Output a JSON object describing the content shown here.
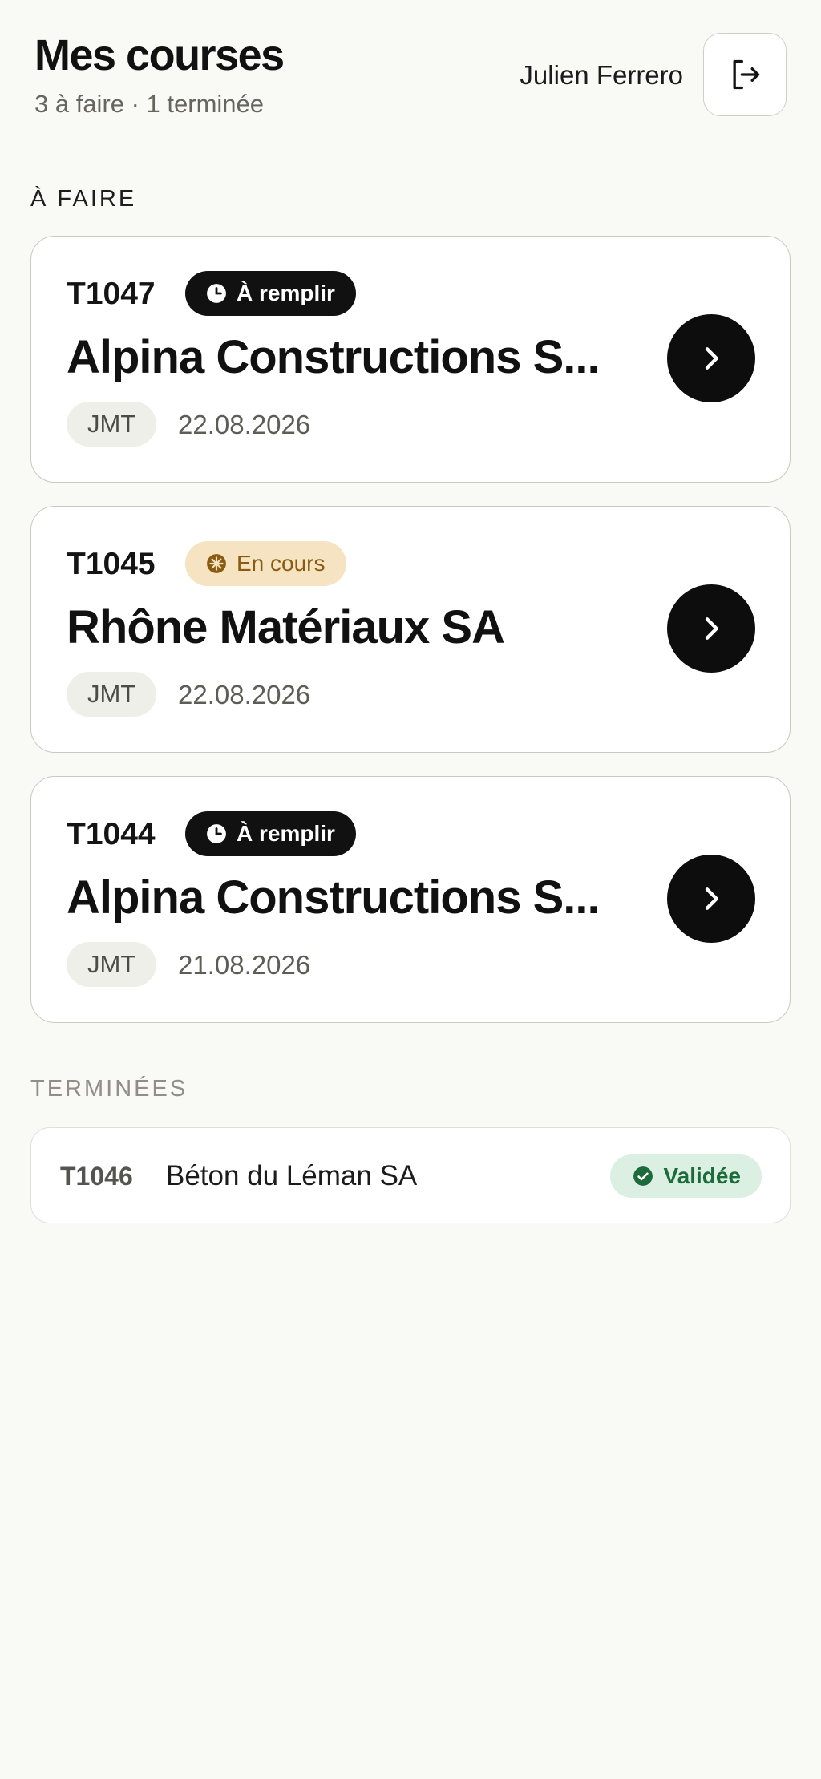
{
  "header": {
    "title": "Mes courses",
    "subtitle": "3 à faire · 1 terminée",
    "user_name": "Julien Ferrero",
    "logout_icon": "logout-icon"
  },
  "sections": {
    "todo_label": "À FAIRE",
    "done_label": "TERMINÉES"
  },
  "todo": [
    {
      "id": "T1047",
      "status": "À remplir",
      "status_icon": "clock-icon",
      "client": "Alpina Constructions S...",
      "code": "JMT",
      "date": "22.08.2026"
    },
    {
      "id": "T1045",
      "status": "En cours",
      "status_icon": "progress-icon",
      "client": "Rhône Matériaux SA",
      "code": "JMT",
      "date": "22.08.2026"
    },
    {
      "id": "T1044",
      "status": "À remplir",
      "status_icon": "clock-icon",
      "client": "Alpina Constructions S...",
      "code": "JMT",
      "date": "21.08.2026"
    }
  ],
  "done": [
    {
      "id": "T1046",
      "client": "Béton du Léman SA",
      "status": "Validée",
      "status_icon": "check-circle-icon"
    }
  ],
  "colors": {
    "background": "#f9f9f5",
    "badge_dark": "#111111",
    "badge_amber_bg": "#f5e3c2",
    "badge_amber_text": "#8a5a10",
    "badge_green_bg": "#dcefe3",
    "badge_green_text": "#1c6b3a"
  }
}
